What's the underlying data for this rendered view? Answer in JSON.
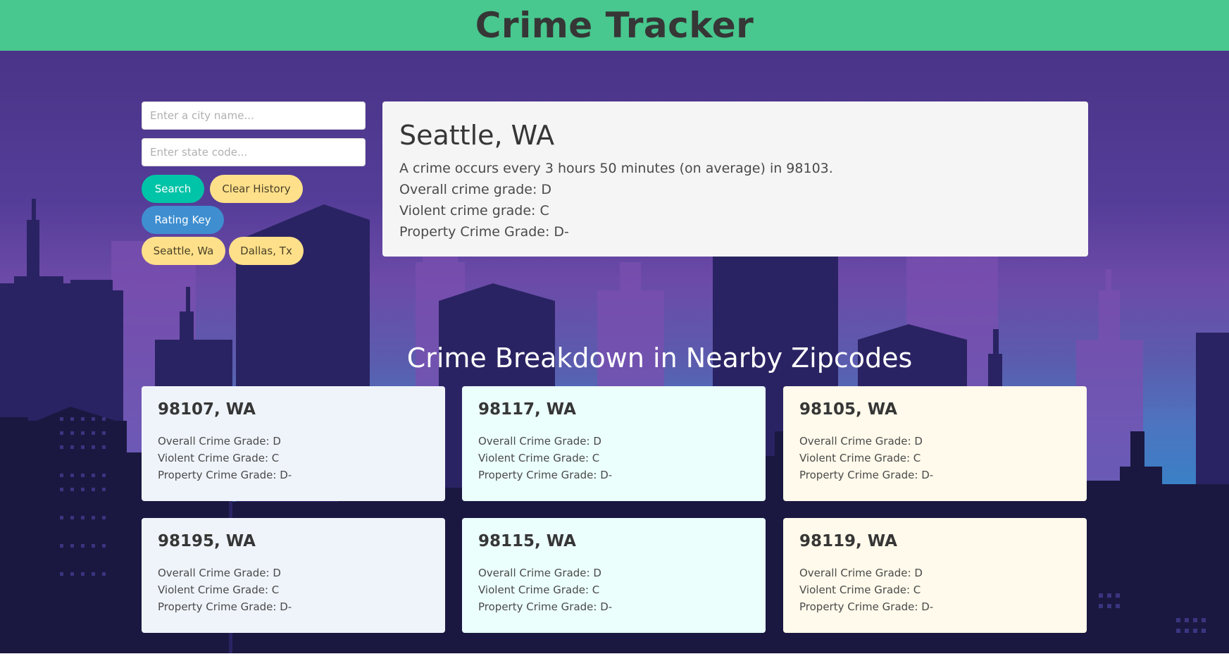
{
  "header": {
    "title": "Crime Tracker"
  },
  "search": {
    "city_placeholder": "Enter a city name...",
    "state_placeholder": "Enter state code...",
    "search_label": "Search",
    "clear_label": "Clear History",
    "rating_key_label": "Rating Key"
  },
  "history": [
    {
      "label": "Seattle, Wa"
    },
    {
      "label": "Dallas, Tx"
    }
  ],
  "main_result": {
    "location": "Seattle, WA",
    "frequency": "A crime occurs every 3 hours 50 minutes (on average) in 98103.",
    "overall": "Overall crime grade: D",
    "violent": "Violent crime grade: C",
    "property": "Property Crime Grade: D-"
  },
  "nearby": {
    "title": "Crime Breakdown in Nearby Zipcodes",
    "cards": [
      {
        "zip": "98107, WA",
        "overall": "Overall Crime Grade: D",
        "violent": "Violent Crime Grade: C",
        "property": "Property Crime Grade: D-",
        "bg": "#eff4fb"
      },
      {
        "zip": "98117, WA",
        "overall": "Overall Crime Grade: D",
        "violent": "Violent Crime Grade: C",
        "property": "Property Crime Grade: D-",
        "bg": "#ebfffc"
      },
      {
        "zip": "98105, WA",
        "overall": "Overall Crime Grade: D",
        "violent": "Violent Crime Grade: C",
        "property": "Property Crime Grade: D-",
        "bg": "#fffaeb"
      },
      {
        "zip": "98195, WA",
        "overall": "Overall Crime Grade: D",
        "violent": "Violent Crime Grade: C",
        "property": "Property Crime Grade: D-",
        "bg": "#eff4fb"
      },
      {
        "zip": "98115, WA",
        "overall": "Overall Crime Grade: D",
        "violent": "Violent Crime Grade: C",
        "property": "Property Crime Grade: D-",
        "bg": "#ebfffc"
      },
      {
        "zip": "98119, WA",
        "overall": "Overall Crime Grade: D",
        "violent": "Violent Crime Grade: C",
        "property": "Property Crime Grade: D-",
        "bg": "#fffaeb"
      }
    ]
  },
  "colors": {
    "header": "#48c78e",
    "search_button": "#00c4a7",
    "history_button": "#ffe08a",
    "rating_button": "#3e8ed0"
  }
}
